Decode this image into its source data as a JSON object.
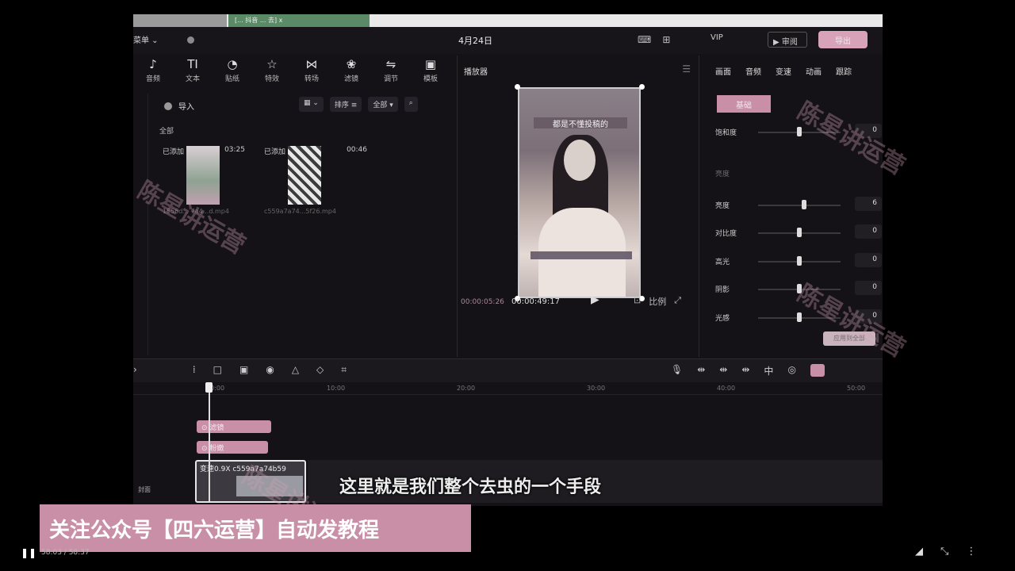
{
  "browser": {
    "tab_title": "[... 抖音 ... 去] x"
  },
  "app": {
    "menu_label": "菜单",
    "date": "4月24日",
    "vip_label": "VIP",
    "share_label": "审阅",
    "export_label": "导出"
  },
  "toolbar": {
    "items": [
      {
        "label": "音频",
        "icon": "♪"
      },
      {
        "label": "文本",
        "icon": "TI"
      },
      {
        "label": "贴纸",
        "icon": "◔"
      },
      {
        "label": "特效",
        "icon": "☆"
      },
      {
        "label": "转场",
        "icon": "⋈"
      },
      {
        "label": "滤镜",
        "icon": "❀"
      },
      {
        "label": "调节",
        "icon": "⇋"
      },
      {
        "label": "模板",
        "icon": "▣"
      }
    ]
  },
  "media": {
    "import_label": "导入",
    "sort_label": "排序",
    "filter_label": "全部",
    "all_label": "全部",
    "clips": [
      {
        "added": "已添加",
        "duration": "03:25",
        "filename": "1556d... 7a4...d.mp4"
      },
      {
        "added": "已添加",
        "duration": "00:46",
        "filename": "c559a7a74...5f26.mp4"
      }
    ]
  },
  "player": {
    "title": "播放器",
    "video_title": "都是不懂投稿的",
    "current_time": "00:00:05:26",
    "total_time": "00:00:49:17",
    "ratio_label": "比例"
  },
  "props": {
    "tabs": [
      "画面",
      "音频",
      "变速",
      "动画",
      "跟踪"
    ],
    "basic_label": "基础",
    "section_label": "亮度",
    "rows": [
      {
        "name": "饱和度",
        "value": "0",
        "level": 0.5
      },
      {
        "name": "亮度",
        "value": "6",
        "level": 0.56
      },
      {
        "name": "对比度",
        "value": "0",
        "level": 0.5
      },
      {
        "name": "高光",
        "value": "0",
        "level": 0.5
      },
      {
        "name": "阴影",
        "value": "0",
        "level": 0.5
      },
      {
        "name": "光感",
        "value": "0",
        "level": 0.5
      }
    ],
    "apply_label": "应用到全部"
  },
  "timeline": {
    "ticks": [
      "00:00",
      "10:00",
      "20:00",
      "30:00",
      "40:00",
      "50:00"
    ],
    "text_clips": [
      "滤镜",
      "粉嫩"
    ],
    "main_clip_label": "变速0.9X  c559a7a74b59",
    "cover_label": "封面"
  },
  "overlay": {
    "watermark": "陈星讲运营",
    "caption": "这里就是我们整个去虫的一个手段",
    "banner": "关注公众号【四六运营】自动发教程"
  },
  "video_controls": {
    "time": "58:03 / 58:37"
  }
}
